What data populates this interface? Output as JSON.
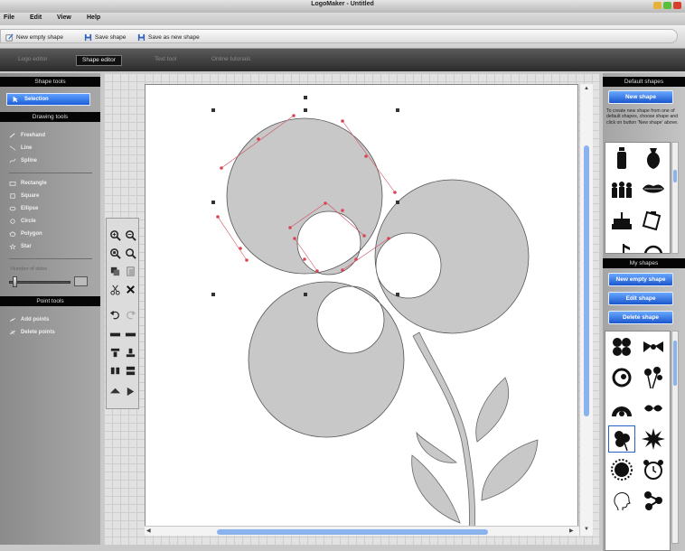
{
  "window": {
    "title": "LogoMaker - Untitled"
  },
  "menu": [
    "File",
    "Edit",
    "View",
    "Help"
  ],
  "toolbar": {
    "new_empty_shape": "New empty shape",
    "save_shape": "Save shape",
    "save_as_new_shape": "Save as new shape"
  },
  "tabs": [
    "Logo editor",
    "Shape editor",
    "Text tool",
    "Online tutorials"
  ],
  "left_panel": {
    "shape_tools_header": "Shape tools",
    "selection": "Selection",
    "drawing_tools_header": "Drawing tools",
    "drawing_tools": [
      "Freehand",
      "Line",
      "Spline",
      "Rectangle",
      "Square",
      "Ellipse",
      "Circle",
      "Polygon",
      "Star"
    ],
    "sides_label": "Number of sides",
    "point_tools_header": "Point tools",
    "point_tools": [
      "Add points",
      "Delete points"
    ]
  },
  "right_panel": {
    "default_shapes_header": "Default shapes",
    "new_shape_button": "New shape",
    "help_text": "To create new shape from one of default shapes, choose shape and click on button 'New shape' above.",
    "default_shape_icons": [
      "bottle-icon",
      "vase-icon",
      "people-icon",
      "lips-icon",
      "cake-icon",
      "clipboard-icon",
      "music-note-icon",
      "headphones-icon"
    ],
    "my_shapes_header": "My shapes",
    "new_empty_shape_button": "New empty shape",
    "edit_shape_button": "Edit shape",
    "delete_shape_button": "Delete shape",
    "my_shape_icons": [
      "clover-icon",
      "bow-icon",
      "swirl-icon",
      "flower-bunch-icon",
      "arch-icon",
      "tribal-icon",
      "flower-icon",
      "starburst-icon",
      "gear-sun-icon",
      "alarm-clock-icon",
      "head-profile-icon",
      "molecule-icon"
    ]
  },
  "colors": {
    "accent_blue": "#1e5fd8",
    "shape_fill": "#c8c8c8",
    "handle_red": "#e04050",
    "panel_header": "#050505"
  }
}
